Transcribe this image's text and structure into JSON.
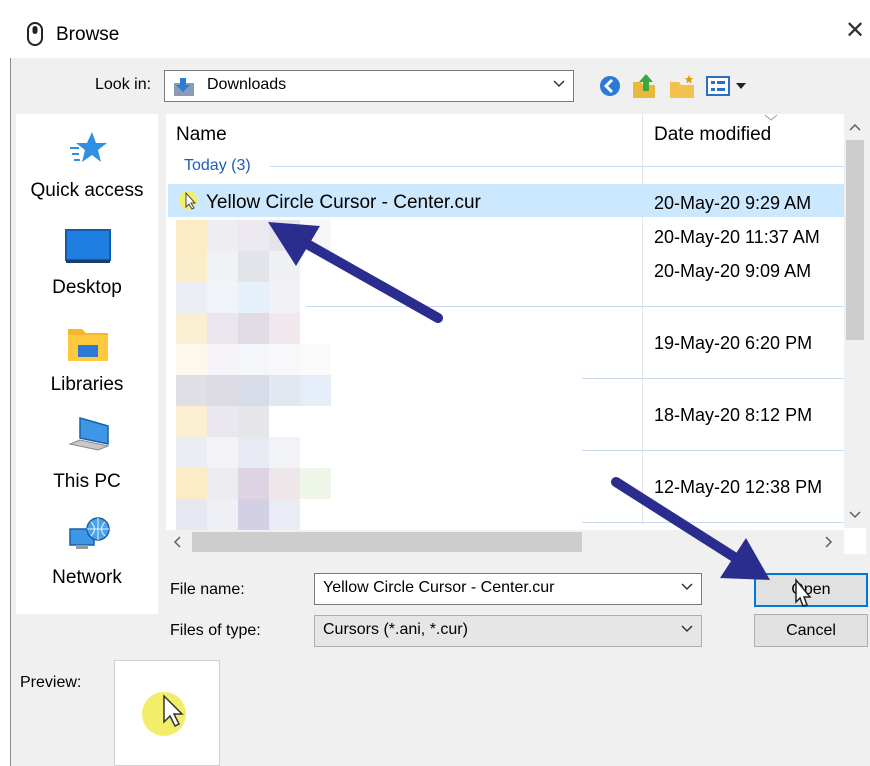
{
  "window": {
    "title": "Browse",
    "close_glyph": "✕"
  },
  "lookin": {
    "label": "Look in:",
    "value": "Downloads"
  },
  "places": [
    {
      "label": "Quick access",
      "icon": "quick-access-star-icon"
    },
    {
      "label": "Desktop",
      "icon": "desktop-icon"
    },
    {
      "label": "Libraries",
      "icon": "libraries-folder-icon"
    },
    {
      "label": "This PC",
      "icon": "this-pc-icon"
    },
    {
      "label": "Network",
      "icon": "network-globe-icon"
    }
  ],
  "columns": {
    "name": "Name",
    "date": "Date modified"
  },
  "groups": {
    "today": "Today (3)"
  },
  "files": {
    "selected_name": "Yellow Circle Cursor - Center.cur",
    "dates": [
      "20-May-20 9:29 AM",
      "20-May-20 11:37 AM",
      "20-May-20 9:09 AM",
      "19-May-20 6:20 PM",
      "18-May-20 8:12 PM",
      "12-May-20 12:38 PM"
    ]
  },
  "filename": {
    "label": "File name:",
    "value": "Yellow Circle Cursor - Center.cur"
  },
  "filetype": {
    "label": "Files of type:",
    "value": "Cursors (*.ani, *.cur)"
  },
  "buttons": {
    "open": "Open",
    "cancel": "Cancel"
  },
  "preview": {
    "label": "Preview:"
  },
  "colors": {
    "accent": "#0078d7",
    "arrow": "#2b2d8e",
    "selection": "#cce8ff",
    "cursor_yellow": "#f3ee6a"
  }
}
